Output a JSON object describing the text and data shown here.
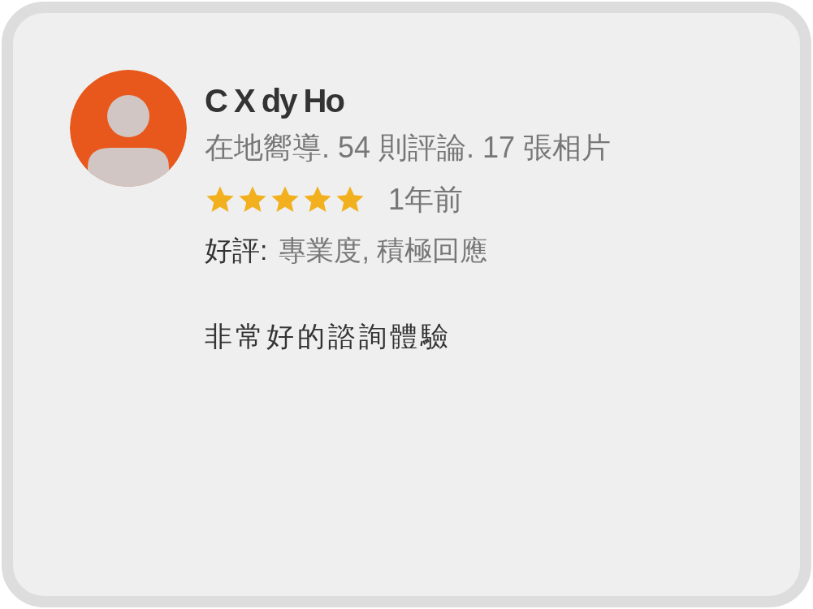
{
  "review": {
    "author": "C X dy Ho",
    "meta": "在地嚮導. 54 則評論. 17 張相片",
    "stars": 5,
    "time": "1年前",
    "highlights_label": "好評:",
    "highlights": "專業度, 積極回應",
    "text": "非常好的諮詢體驗"
  }
}
